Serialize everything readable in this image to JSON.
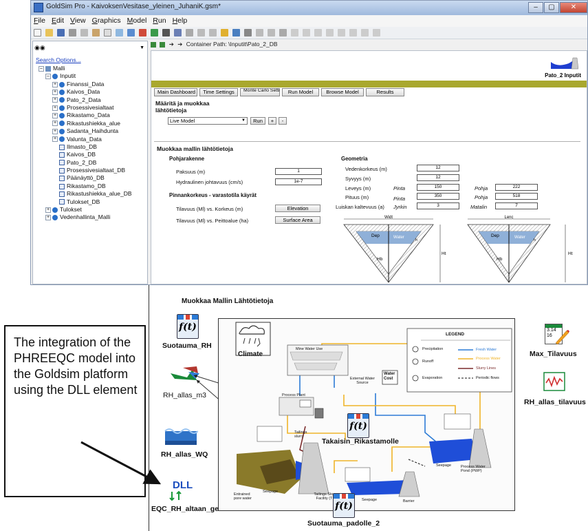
{
  "window": {
    "title": "GoldSim Pro - KaivoksenVesitase_yleinen_JuhaniK.gsm*",
    "buttons": [
      "–",
      "▢",
      "✕"
    ]
  },
  "menu": [
    "File",
    "Edit",
    "View",
    "Graphics",
    "Model",
    "Run",
    "Help"
  ],
  "tree_pane": {
    "search_options": "Search Options...",
    "items": [
      {
        "label": "Malli",
        "level": 0,
        "expander": "–"
      },
      {
        "label": "Inputit",
        "level": 1,
        "expander": "–"
      },
      {
        "label": "Finanssi_Data",
        "level": 2,
        "expander": "+"
      },
      {
        "label": "Kaivos_Data",
        "level": 2,
        "expander": "+"
      },
      {
        "label": "Pato_2_Data",
        "level": 2,
        "expander": "+"
      },
      {
        "label": "Prosessivesialtaat",
        "level": 2,
        "expander": "+"
      },
      {
        "label": "Rikastamo_Data",
        "level": 2,
        "expander": "+"
      },
      {
        "label": "Rikastushiekka_alue",
        "level": 2,
        "expander": "+"
      },
      {
        "label": "Sadanta_Haihdunta",
        "level": 2,
        "expander": "+"
      },
      {
        "label": "Valunta_Data",
        "level": 2,
        "expander": "+"
      },
      {
        "label": "Ilmasto_DB",
        "level": 2,
        "expander": ""
      },
      {
        "label": "Kaivos_DB",
        "level": 2,
        "expander": ""
      },
      {
        "label": "Pato_2_DB",
        "level": 2,
        "expander": ""
      },
      {
        "label": "Prosessivesialtaat_DB",
        "level": 2,
        "expander": ""
      },
      {
        "label": "Päänäyttö_DB",
        "level": 2,
        "expander": ""
      },
      {
        "label": "Rikastamo_DB",
        "level": 2,
        "expander": ""
      },
      {
        "label": "Rikastushiekka_alue_DB",
        "level": 2,
        "expander": ""
      },
      {
        "label": "Tulokset_DB",
        "level": 2,
        "expander": ""
      },
      {
        "label": "Tulokset",
        "level": 1,
        "expander": "+"
      },
      {
        "label": "Vedenhallinta_Malli",
        "level": 1,
        "expander": "+"
      }
    ]
  },
  "container_path": "Container Path:  \\Inputit\\Pato_2_DB",
  "dashboard": {
    "badge": "Pato_2 Inputit",
    "tabs": [
      "Main Dashboard",
      "Time Settings",
      "Monte Carlo Settings",
      "Run Model",
      "Browse Model",
      "Results"
    ],
    "heading1": "Määritä ja muokkaa lähtötietoja",
    "live_model": "Live Model",
    "run_label": "Run",
    "plus_label": "+",
    "minus_label": "-",
    "heading2": "Muokkaa mallin lähtötietoja",
    "pohjarakenne": "Pohjarakenne",
    "paksuus_label": "Paksuus (m)",
    "paksuus_value": "1",
    "hydr_label": "Hydraulinen johtavuus (cm/s)",
    "hydr_value": "1e-7",
    "pinnankorkeus": "Pinnankorkeus - varastotila käyrät",
    "tilavuus1": "Tilavuus (Ml) vs. Korkeus (m)",
    "elevation_btn": "Elevation",
    "tilavuus2": "Tilavuus (Ml) vs. Peittoalue (ha)",
    "surface_btn": "Surface Area",
    "geometria": "Geometria",
    "vedenkorkeus_label": "Vedenkorkeus (m)",
    "vedenkorkeus_value": "12",
    "syvyys_label": "Syvyys (m)",
    "syvyys_value": "12",
    "leveys_label": "Leveys (m)",
    "pituus_label": "Pituus (m)",
    "luiskan_label": "Luiskan kaltevuus (a)",
    "pinta": "Pinta",
    "pohja": "Pohja",
    "jyrkin": "Jyrkin",
    "matalin": "Matalin",
    "leveys_pinta": "150",
    "leveys_pohja": "222",
    "pituus_pinta": "350",
    "pituus_pohja": "518",
    "jyrkin_value": "3",
    "matalin_value": "7",
    "diag_left": {
      "top": "Widt",
      "dep": "Dep",
      "water": "Water",
      "hb": "Hb",
      "ht": "Ht",
      "h": "h"
    },
    "diag_right": {
      "top": "Lenc",
      "dep": "Dep",
      "water": "Water",
      "hb": "Hb",
      "ht": "Ht",
      "h": "h"
    }
  },
  "model": {
    "title": "Muokkaa Mallin Lähtötietoja",
    "elements": {
      "suotauma_rh": "Suotauma_RH",
      "climate": "Climate",
      "rh_allas_m3": "RH_allas_m3",
      "rh_allas_wq": "RH_allas_WQ",
      "dll": "DLL",
      "eqc": "EQC_RH_altaan_geokemia",
      "takaisin": "Takaisin_Rikastamolle",
      "suotauma_padolle": "Suotauma_padolle_2",
      "max_tilavuus": "Max_Tilavuus",
      "rh_allas_tilavuus": "RH_allas_tilavuus",
      "max_icon_text_1": "3.14",
      "max_icon_text_2": "16"
    },
    "diagram": {
      "mine_water_use": "Mine Water Use",
      "process_plant": "Process Plant",
      "external_water_source": "External Water Source",
      "water_cost": "Water Cost",
      "tailings_slurry": "Tailings slurry",
      "tailings_storage": "Tailings Storage Facility (TSF)",
      "seepage1": "Seepage",
      "seepage2": "Seepage",
      "seepage3": "Seepage",
      "entrained": "Entrained pore water",
      "process_water_pond": "Process Water Pond (PWP)",
      "barrier": "Barrier"
    },
    "legend": {
      "title": "LEGEND",
      "rows": [
        {
          "left": "Precipitation",
          "right": "Fresh Water"
        },
        {
          "left": "Runoff",
          "right": "Process Water"
        },
        {
          "left": "",
          "right": "Slurry Lines"
        },
        {
          "left": "Evaporation",
          "right": "Periodic flows"
        }
      ]
    }
  },
  "annotation": {
    "text": "The integration of the PHREEQC model into the Goldsim platform using the DLL element"
  },
  "colors": {
    "olive": "#a9a82e",
    "fresh_water": "#2c7bd6",
    "process_water": "#f0b429",
    "slurry": "#7a2a2a",
    "pond_blue": "#1f4ed8"
  }
}
